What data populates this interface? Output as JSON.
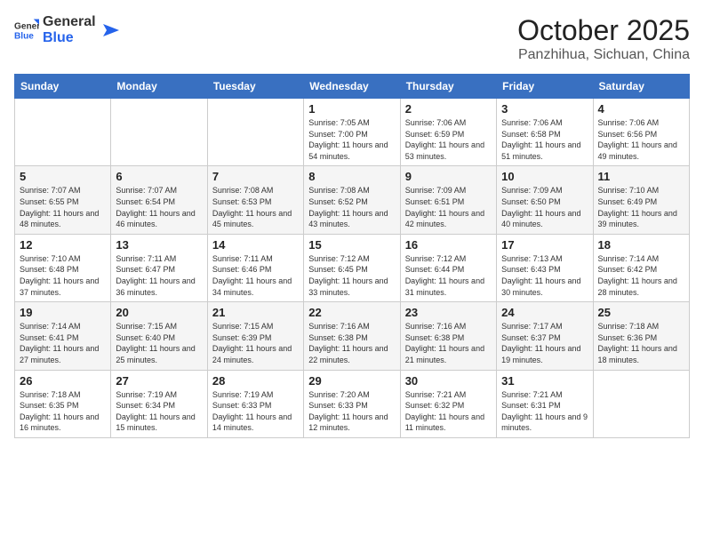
{
  "logo": {
    "text_general": "General",
    "text_blue": "Blue"
  },
  "header": {
    "month": "October 2025",
    "location": "Panzhihua, Sichuan, China"
  },
  "days_of_week": [
    "Sunday",
    "Monday",
    "Tuesday",
    "Wednesday",
    "Thursday",
    "Friday",
    "Saturday"
  ],
  "weeks": [
    [
      {
        "day": "",
        "sunrise": "",
        "sunset": "",
        "daylight": ""
      },
      {
        "day": "",
        "sunrise": "",
        "sunset": "",
        "daylight": ""
      },
      {
        "day": "",
        "sunrise": "",
        "sunset": "",
        "daylight": ""
      },
      {
        "day": "1",
        "sunrise": "Sunrise: 7:05 AM",
        "sunset": "Sunset: 7:00 PM",
        "daylight": "Daylight: 11 hours and 54 minutes."
      },
      {
        "day": "2",
        "sunrise": "Sunrise: 7:06 AM",
        "sunset": "Sunset: 6:59 PM",
        "daylight": "Daylight: 11 hours and 53 minutes."
      },
      {
        "day": "3",
        "sunrise": "Sunrise: 7:06 AM",
        "sunset": "Sunset: 6:58 PM",
        "daylight": "Daylight: 11 hours and 51 minutes."
      },
      {
        "day": "4",
        "sunrise": "Sunrise: 7:06 AM",
        "sunset": "Sunset: 6:56 PM",
        "daylight": "Daylight: 11 hours and 49 minutes."
      }
    ],
    [
      {
        "day": "5",
        "sunrise": "Sunrise: 7:07 AM",
        "sunset": "Sunset: 6:55 PM",
        "daylight": "Daylight: 11 hours and 48 minutes."
      },
      {
        "day": "6",
        "sunrise": "Sunrise: 7:07 AM",
        "sunset": "Sunset: 6:54 PM",
        "daylight": "Daylight: 11 hours and 46 minutes."
      },
      {
        "day": "7",
        "sunrise": "Sunrise: 7:08 AM",
        "sunset": "Sunset: 6:53 PM",
        "daylight": "Daylight: 11 hours and 45 minutes."
      },
      {
        "day": "8",
        "sunrise": "Sunrise: 7:08 AM",
        "sunset": "Sunset: 6:52 PM",
        "daylight": "Daylight: 11 hours and 43 minutes."
      },
      {
        "day": "9",
        "sunrise": "Sunrise: 7:09 AM",
        "sunset": "Sunset: 6:51 PM",
        "daylight": "Daylight: 11 hours and 42 minutes."
      },
      {
        "day": "10",
        "sunrise": "Sunrise: 7:09 AM",
        "sunset": "Sunset: 6:50 PM",
        "daylight": "Daylight: 11 hours and 40 minutes."
      },
      {
        "day": "11",
        "sunrise": "Sunrise: 7:10 AM",
        "sunset": "Sunset: 6:49 PM",
        "daylight": "Daylight: 11 hours and 39 minutes."
      }
    ],
    [
      {
        "day": "12",
        "sunrise": "Sunrise: 7:10 AM",
        "sunset": "Sunset: 6:48 PM",
        "daylight": "Daylight: 11 hours and 37 minutes."
      },
      {
        "day": "13",
        "sunrise": "Sunrise: 7:11 AM",
        "sunset": "Sunset: 6:47 PM",
        "daylight": "Daylight: 11 hours and 36 minutes."
      },
      {
        "day": "14",
        "sunrise": "Sunrise: 7:11 AM",
        "sunset": "Sunset: 6:46 PM",
        "daylight": "Daylight: 11 hours and 34 minutes."
      },
      {
        "day": "15",
        "sunrise": "Sunrise: 7:12 AM",
        "sunset": "Sunset: 6:45 PM",
        "daylight": "Daylight: 11 hours and 33 minutes."
      },
      {
        "day": "16",
        "sunrise": "Sunrise: 7:12 AM",
        "sunset": "Sunset: 6:44 PM",
        "daylight": "Daylight: 11 hours and 31 minutes."
      },
      {
        "day": "17",
        "sunrise": "Sunrise: 7:13 AM",
        "sunset": "Sunset: 6:43 PM",
        "daylight": "Daylight: 11 hours and 30 minutes."
      },
      {
        "day": "18",
        "sunrise": "Sunrise: 7:14 AM",
        "sunset": "Sunset: 6:42 PM",
        "daylight": "Daylight: 11 hours and 28 minutes."
      }
    ],
    [
      {
        "day": "19",
        "sunrise": "Sunrise: 7:14 AM",
        "sunset": "Sunset: 6:41 PM",
        "daylight": "Daylight: 11 hours and 27 minutes."
      },
      {
        "day": "20",
        "sunrise": "Sunrise: 7:15 AM",
        "sunset": "Sunset: 6:40 PM",
        "daylight": "Daylight: 11 hours and 25 minutes."
      },
      {
        "day": "21",
        "sunrise": "Sunrise: 7:15 AM",
        "sunset": "Sunset: 6:39 PM",
        "daylight": "Daylight: 11 hours and 24 minutes."
      },
      {
        "day": "22",
        "sunrise": "Sunrise: 7:16 AM",
        "sunset": "Sunset: 6:38 PM",
        "daylight": "Daylight: 11 hours and 22 minutes."
      },
      {
        "day": "23",
        "sunrise": "Sunrise: 7:16 AM",
        "sunset": "Sunset: 6:38 PM",
        "daylight": "Daylight: 11 hours and 21 minutes."
      },
      {
        "day": "24",
        "sunrise": "Sunrise: 7:17 AM",
        "sunset": "Sunset: 6:37 PM",
        "daylight": "Daylight: 11 hours and 19 minutes."
      },
      {
        "day": "25",
        "sunrise": "Sunrise: 7:18 AM",
        "sunset": "Sunset: 6:36 PM",
        "daylight": "Daylight: 11 hours and 18 minutes."
      }
    ],
    [
      {
        "day": "26",
        "sunrise": "Sunrise: 7:18 AM",
        "sunset": "Sunset: 6:35 PM",
        "daylight": "Daylight: 11 hours and 16 minutes."
      },
      {
        "day": "27",
        "sunrise": "Sunrise: 7:19 AM",
        "sunset": "Sunset: 6:34 PM",
        "daylight": "Daylight: 11 hours and 15 minutes."
      },
      {
        "day": "28",
        "sunrise": "Sunrise: 7:19 AM",
        "sunset": "Sunset: 6:33 PM",
        "daylight": "Daylight: 11 hours and 14 minutes."
      },
      {
        "day": "29",
        "sunrise": "Sunrise: 7:20 AM",
        "sunset": "Sunset: 6:33 PM",
        "daylight": "Daylight: 11 hours and 12 minutes."
      },
      {
        "day": "30",
        "sunrise": "Sunrise: 7:21 AM",
        "sunset": "Sunset: 6:32 PM",
        "daylight": "Daylight: 11 hours and 11 minutes."
      },
      {
        "day": "31",
        "sunrise": "Sunrise: 7:21 AM",
        "sunset": "Sunset: 6:31 PM",
        "daylight": "Daylight: 11 hours and 9 minutes."
      },
      {
        "day": "",
        "sunrise": "",
        "sunset": "",
        "daylight": ""
      }
    ]
  ]
}
